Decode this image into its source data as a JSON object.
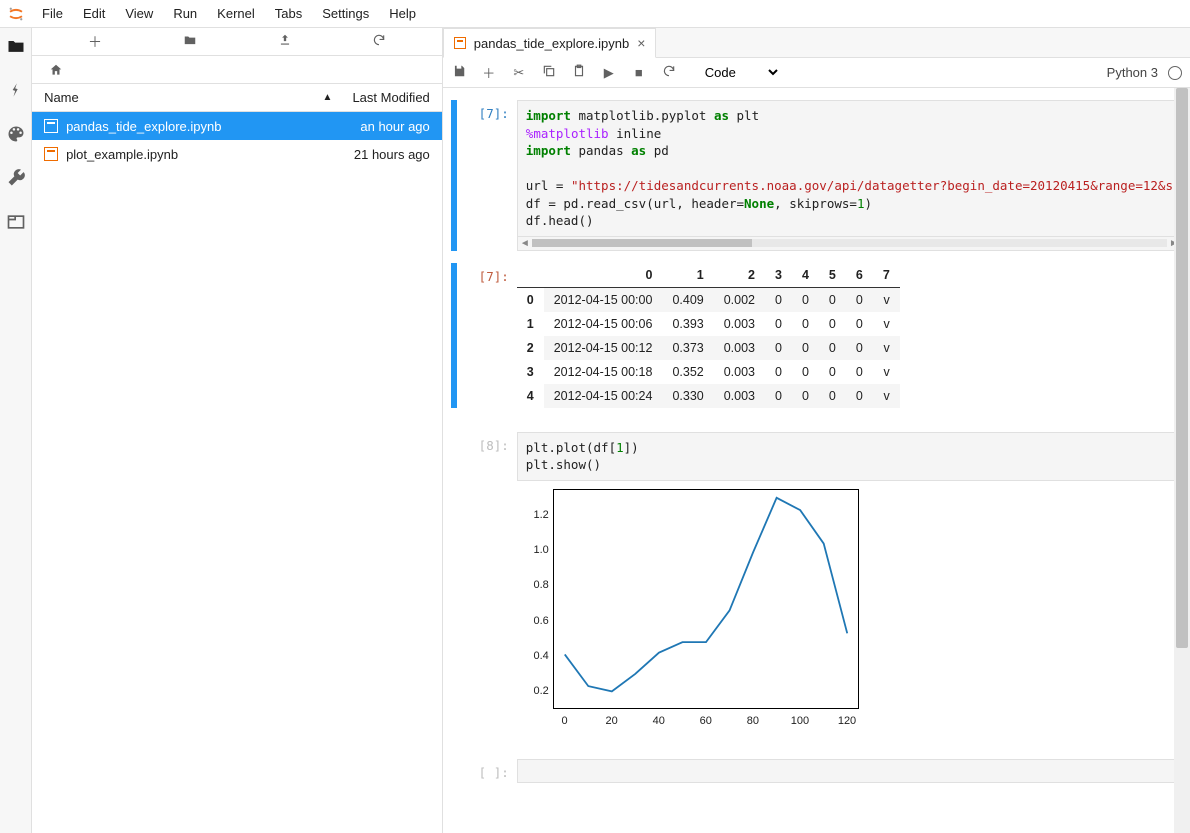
{
  "menu": [
    "File",
    "Edit",
    "View",
    "Run",
    "Kernel",
    "Tabs",
    "Settings",
    "Help"
  ],
  "filebrowser": {
    "header_name": "Name",
    "header_modified": "Last Modified",
    "files": [
      {
        "name": "pandas_tide_explore.ipynb",
        "modified": "an hour ago",
        "selected": true
      },
      {
        "name": "plot_example.ipynb",
        "modified": "21 hours ago",
        "selected": false
      }
    ]
  },
  "tab": {
    "title": "pandas_tide_explore.ipynb"
  },
  "toolbar": {
    "celltype": "Code",
    "kernel": "Python 3"
  },
  "cell1": {
    "prompt": "[7]:",
    "code": {
      "l1": {
        "a": "import",
        "b": " matplotlib.pyplot ",
        "c": "as",
        "d": " plt"
      },
      "l2": {
        "a": "%",
        "b": "matplotlib",
        " ": " ",
        "c": "inline"
      },
      "l3": {
        "a": "import",
        "b": " pandas ",
        "c": "as",
        "d": " pd"
      },
      "l4": "",
      "l5": {
        "a": "url = ",
        "b": "\"https://tidesandcurrents.noaa.gov/api/datagetter?begin_date=20120415&range=12&s"
      },
      "l6": {
        "a": "df = pd.read_csv(url, header=",
        "b": "None",
        "c": ", skiprows=",
        "d": "1",
        "e": ")"
      },
      "l7": {
        "a": "df.head()"
      }
    }
  },
  "out1": {
    "prompt": "[7]:",
    "headers": [
      "",
      "0",
      "1",
      "2",
      "3",
      "4",
      "5",
      "6",
      "7"
    ],
    "rows": [
      [
        "0",
        "2012-04-15 00:00",
        "0.409",
        "0.002",
        "0",
        "0",
        "0",
        "0",
        "v"
      ],
      [
        "1",
        "2012-04-15 00:06",
        "0.393",
        "0.003",
        "0",
        "0",
        "0",
        "0",
        "v"
      ],
      [
        "2",
        "2012-04-15 00:12",
        "0.373",
        "0.003",
        "0",
        "0",
        "0",
        "0",
        "v"
      ],
      [
        "3",
        "2012-04-15 00:18",
        "0.352",
        "0.003",
        "0",
        "0",
        "0",
        "0",
        "v"
      ],
      [
        "4",
        "2012-04-15 00:24",
        "0.330",
        "0.003",
        "0",
        "0",
        "0",
        "0",
        "v"
      ]
    ]
  },
  "cell2": {
    "prompt": "[8]:",
    "code": {
      "l1": {
        "a": "plt.plot(df[",
        "b": "1",
        "c": "])"
      },
      "l2": {
        "a": "plt.show()"
      }
    }
  },
  "cell3": {
    "prompt": "[ ]:"
  },
  "chart_data": {
    "type": "line",
    "x": [
      0,
      10,
      20,
      30,
      40,
      50,
      60,
      70,
      80,
      90,
      100,
      110,
      120
    ],
    "values": [
      0.41,
      0.23,
      0.2,
      0.3,
      0.42,
      0.48,
      0.48,
      0.66,
      0.99,
      1.3,
      1.23,
      1.04,
      0.53
    ],
    "xlabel": "",
    "ylabel": "",
    "xlim": [
      0,
      120
    ],
    "ylim": [
      0.2,
      1.2
    ],
    "yticks": [
      0.2,
      0.4,
      0.6,
      0.8,
      1.0,
      1.2
    ],
    "xticks": [
      0,
      20,
      40,
      60,
      80,
      100,
      120
    ]
  }
}
